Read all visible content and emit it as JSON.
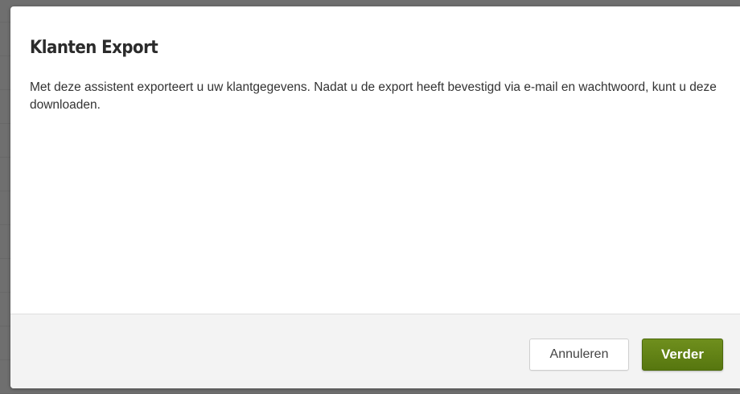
{
  "dialog": {
    "title": "Klanten Export",
    "body_text": "Met deze assistent exporteert u uw klantgegevens. Nadat u de export heeft bevestigd via e-mail en wachtwoord, kunt u deze downloaden.",
    "buttons": {
      "cancel_label": "Annuleren",
      "continue_label": "Verder"
    }
  },
  "colors": {
    "primary_button": "#5f7f13",
    "footer_background": "#f3f3f3",
    "backdrop": "#6f6f6f"
  }
}
